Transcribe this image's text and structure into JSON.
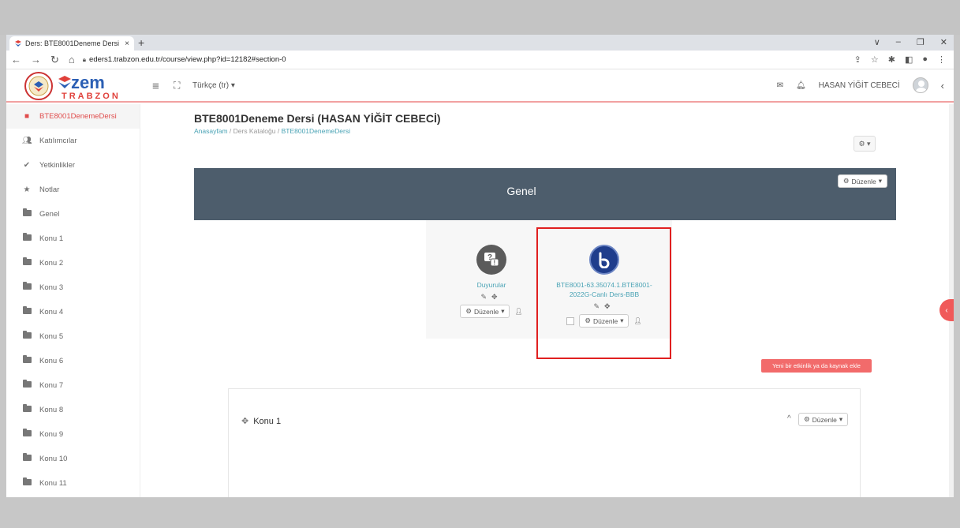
{
  "browser": {
    "tab_title": "Ders: BTE8001Deneme Dersi (HA",
    "tab_close": "×",
    "new_tab": "+",
    "url": "eders1.trabzon.edu.tr/course/view.php?id=12182#section-0",
    "window_controls": [
      "∨",
      "–",
      "❐",
      "✕"
    ]
  },
  "navbar": {
    "logo_text": "zem",
    "logo_subtext": "TRABZON",
    "language": "Türkçe (tr) ▾",
    "user_name": "HASAN YİĞİT CEBECİ"
  },
  "sidebar": {
    "items": [
      {
        "label": "BTE8001DenemeDersi",
        "icon": "graduation-cap-icon"
      },
      {
        "label": "Katılımcılar",
        "icon": "users-icon"
      },
      {
        "label": "Yetkinlikler",
        "icon": "check-circle-icon"
      },
      {
        "label": "Notlar",
        "icon": "star-icon"
      },
      {
        "label": "Genel",
        "icon": "folder-icon"
      },
      {
        "label": "Konu 1",
        "icon": "folder-icon"
      },
      {
        "label": "Konu 2",
        "icon": "folder-icon"
      },
      {
        "label": "Konu 3",
        "icon": "folder-icon"
      },
      {
        "label": "Konu 4",
        "icon": "folder-icon"
      },
      {
        "label": "Konu 5",
        "icon": "folder-icon"
      },
      {
        "label": "Konu 6",
        "icon": "folder-icon"
      },
      {
        "label": "Konu 7",
        "icon": "folder-icon"
      },
      {
        "label": "Konu 8",
        "icon": "folder-icon"
      },
      {
        "label": "Konu 9",
        "icon": "folder-icon"
      },
      {
        "label": "Konu 10",
        "icon": "folder-icon"
      },
      {
        "label": "Konu 11",
        "icon": "folder-icon"
      }
    ]
  },
  "main": {
    "page_title": "BTE8001Deneme Dersi (HASAN YİĞİT CEBECİ)",
    "breadcrumb": {
      "home": "Anasayfam",
      "sep": " / ",
      "catalog": "Ders Kataloğu",
      "course": "BTE8001DenemeDersi"
    },
    "gear_menu": "⚙ ▾",
    "section_title": "Genel",
    "edit_label": "Düzenle",
    "activities": [
      {
        "name": "Duyurular",
        "icon": "forum-icon"
      },
      {
        "name": "BTE8001-63.35074.1.BTE8001-2022G-Canlı Ders-BBB",
        "icon": "bigbluebutton-icon"
      }
    ],
    "add_activity": "Yeni bir etkinlik ya da kaynak ekle",
    "konu1_title": "Konu 1"
  },
  "colors": {
    "accent": "#e04c4c",
    "section_header": "#4d5d6c",
    "link": "#4aa3b5",
    "highlight_box": "#e02020",
    "bbb_blue": "#1f3d8c"
  }
}
